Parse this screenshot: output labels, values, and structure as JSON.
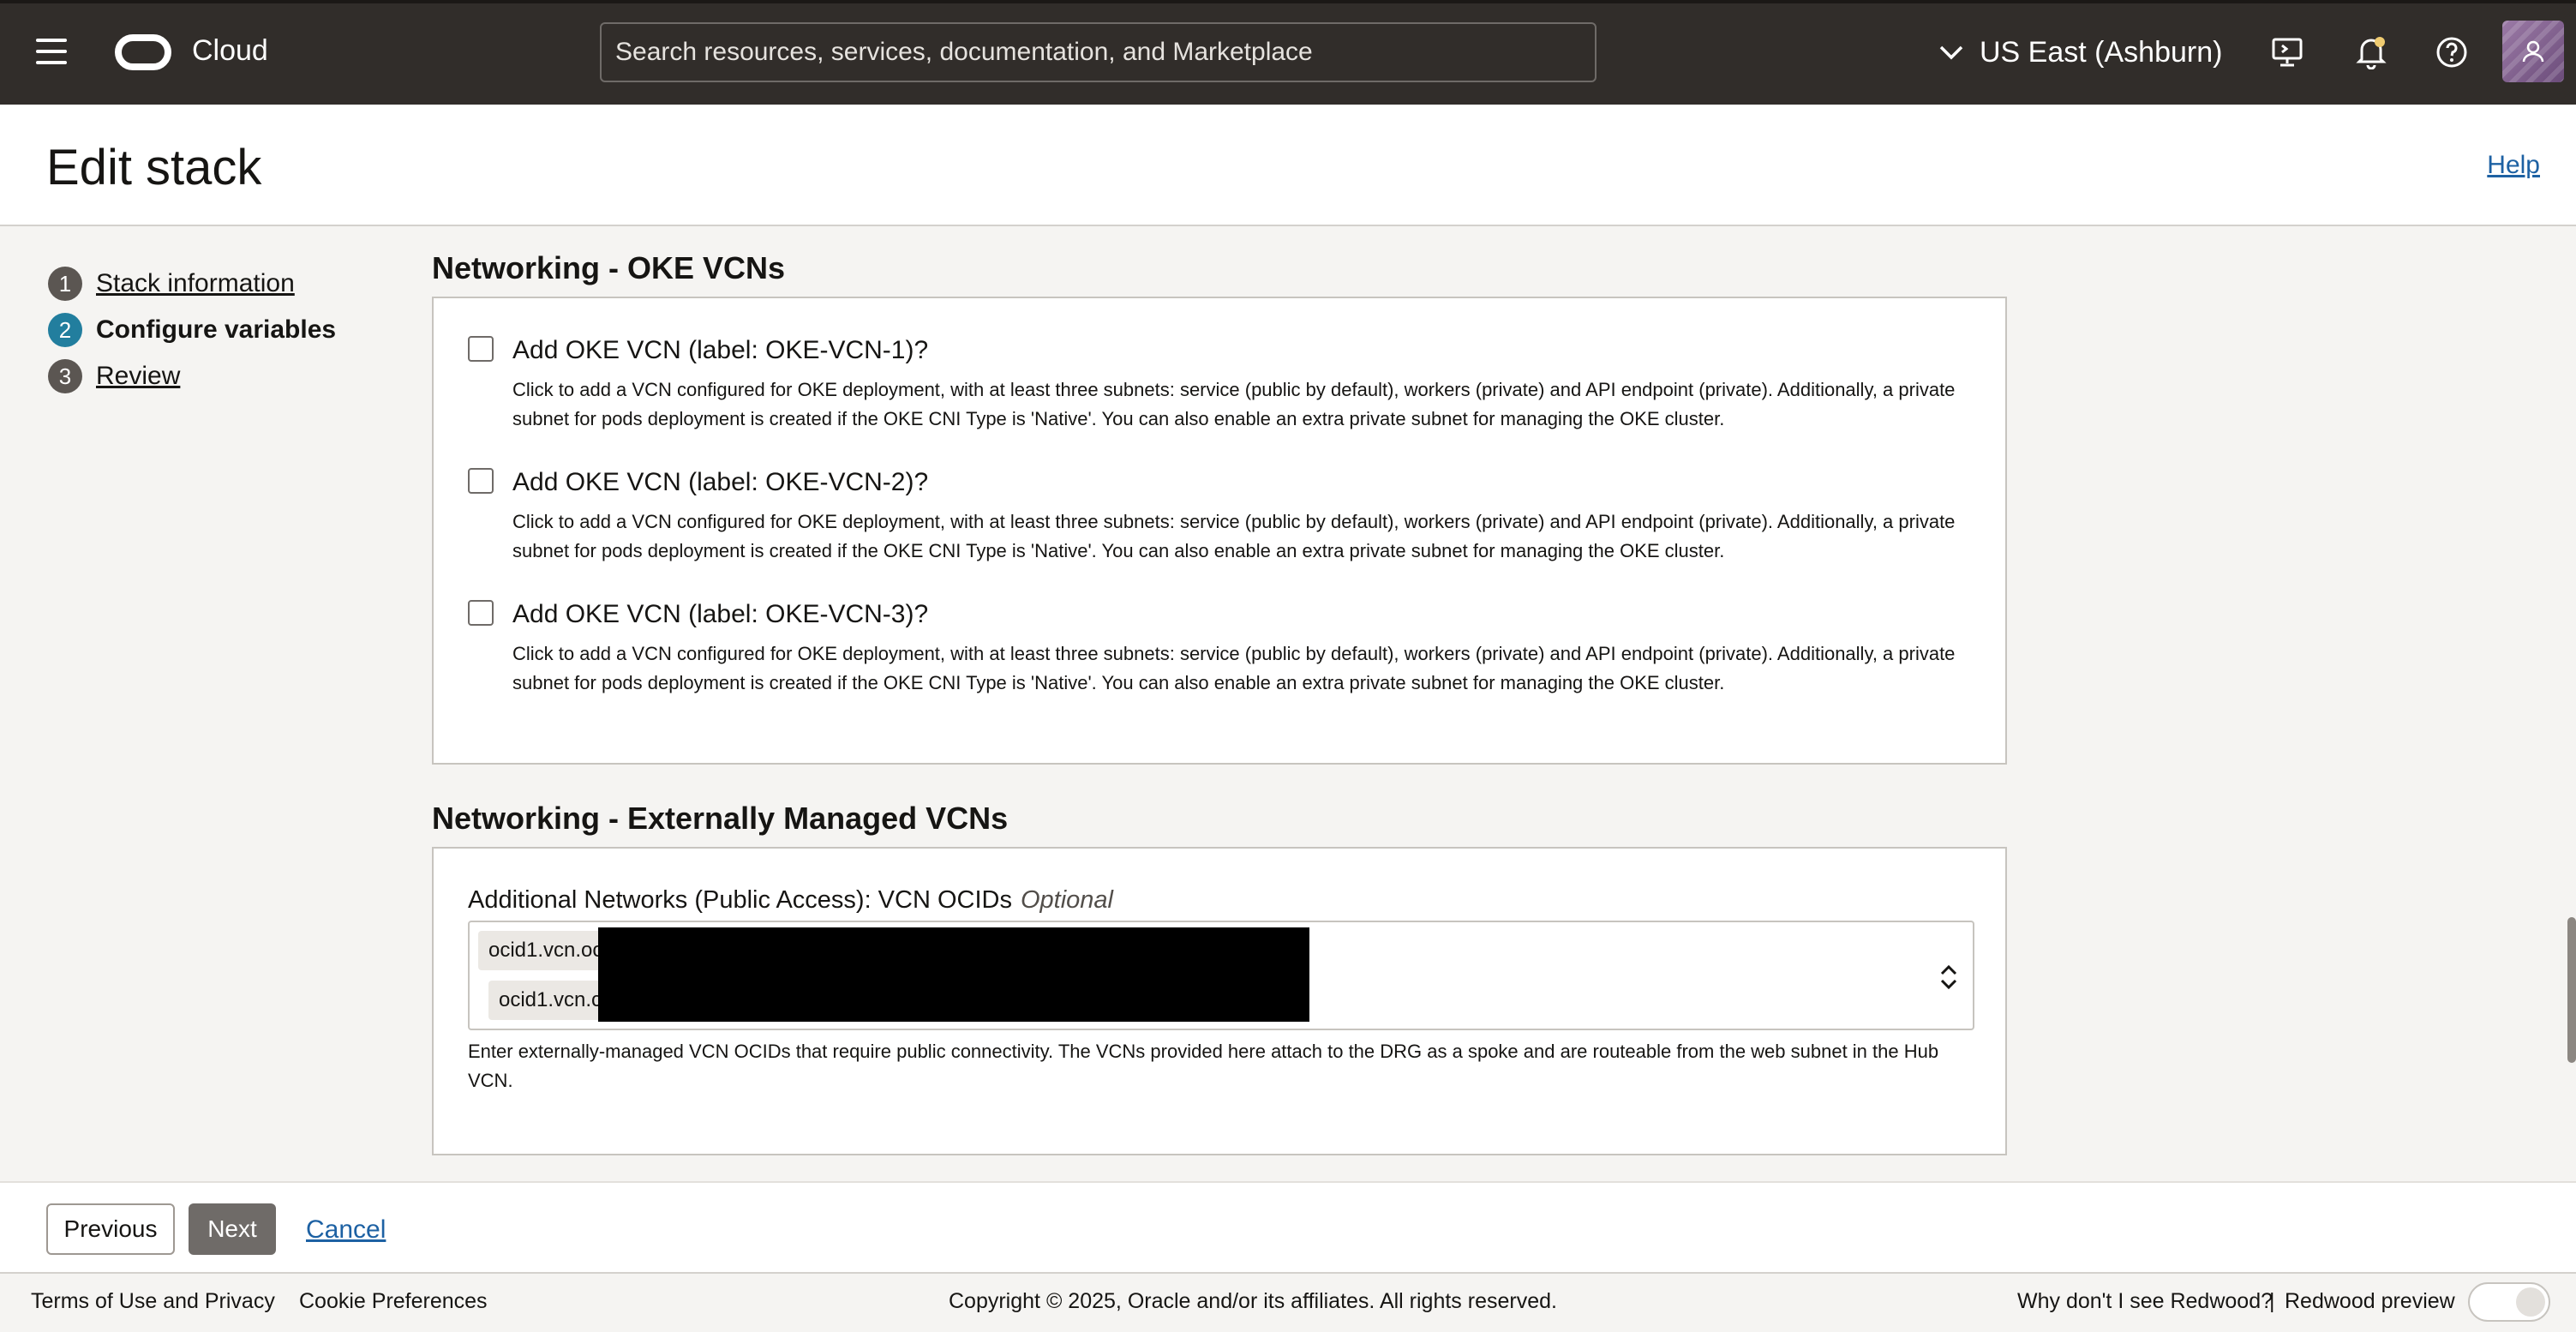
{
  "topbar": {
    "menu_icon": "hamburger-menu-icon",
    "brand": "Cloud",
    "search_placeholder": "Search resources, services, documentation, and Marketplace",
    "region": "US East (Ashburn)",
    "icons": [
      "chevron-down-icon",
      "cloud-shell-icon",
      "bell-icon",
      "help-icon",
      "user-avatar-icon"
    ]
  },
  "header": {
    "title": "Edit stack",
    "help": "Help"
  },
  "steps": [
    {
      "num": "1",
      "label": "Stack information"
    },
    {
      "num": "2",
      "label": "Configure variables"
    },
    {
      "num": "3",
      "label": "Review"
    }
  ],
  "oke": {
    "title": "Networking - OKE VCNs",
    "items": [
      {
        "label": "Add OKE VCN (label: OKE-VCN-1)?",
        "desc": "Click to add a VCN configured for OKE deployment, with at least three subnets: service (public by default), workers (private) and API endpoint (private). Additionally, a private subnet for pods deployment is created if the OKE CNI Type is 'Native'. You can also enable an extra private subnet for managing the OKE cluster.",
        "checked": false
      },
      {
        "label": "Add OKE VCN (label: OKE-VCN-2)?",
        "desc": "Click to add a VCN configured for OKE deployment, with at least three subnets: service (public by default), workers (private) and API endpoint (private). Additionally, a private subnet for pods deployment is created if the OKE CNI Type is 'Native'. You can also enable an extra private subnet for managing the OKE cluster.",
        "checked": false
      },
      {
        "label": "Add OKE VCN (label: OKE-VCN-3)?",
        "desc": "Click to add a VCN configured for OKE deployment, with at least three subnets: service (public by default), workers (private) and API endpoint (private). Additionally, a private subnet for pods deployment is created if the OKE CNI Type is 'Native'. You can also enable an extra private subnet for managing the OKE cluster.",
        "checked": false
      }
    ]
  },
  "external": {
    "title": "Networking - Externally Managed VCNs",
    "field_label": "Additional Networks (Public Access): VCN OCIDs",
    "optional": "Optional",
    "tags": [
      "ocid1.vcn.oc",
      "ocid1.vcn.c"
    ],
    "remove_glyph": "×",
    "help": "Enter externally-managed VCN OCIDs that require public connectivity. The VCNs provided here attach to the DRG as a spoke and are routeable from the web subnet in the Hub VCN."
  },
  "actions": {
    "previous": "Previous",
    "next": "Next",
    "cancel": "Cancel"
  },
  "footer": {
    "terms": "Terms of Use and Privacy",
    "cookies": "Cookie Preferences",
    "copyright": "Copyright © 2025, Oracle and/or its affiliates. All rights reserved.",
    "why_redwood": "Why don't I see Redwood?",
    "separator": "|",
    "redwood_preview": "Redwood preview"
  }
}
